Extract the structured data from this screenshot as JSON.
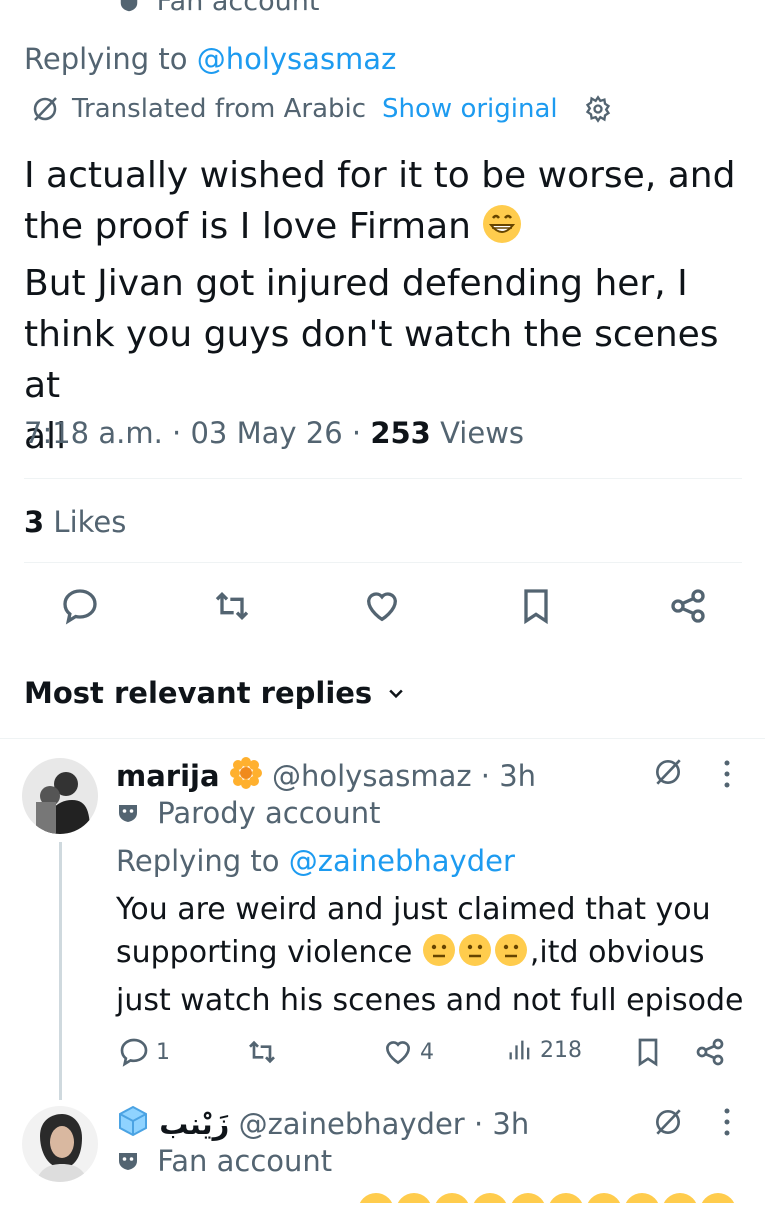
{
  "top_partial": {
    "label": "Fan account"
  },
  "tweet": {
    "replying_prefix": "Replying to",
    "replying_handle": "@holysasmaz",
    "translated_label": "Translated from Arabic",
    "show_original_label": "Show original",
    "text_lines": [
      "I actually wished for it to be worse, and",
      "the proof is I love Firman",
      "But Jivan got injured defending her, I",
      "think you guys don't watch the scenes at",
      "all"
    ],
    "time": "7:18 a.m.",
    "date": "03 May 26",
    "views_count": "253",
    "views_label": "Views",
    "likes_count": "3",
    "likes_label": "Likes"
  },
  "sort": {
    "label": "Most relevant replies"
  },
  "replies": [
    {
      "name": "marija",
      "handle": "@holysasmaz",
      "time": "3h",
      "badge": "Parody account",
      "replying_prefix": "Replying to",
      "replying_handle": "@zainebhayder",
      "text_lines": [
        "You are weird and just claimed that you",
        "supporting violence",
        ",itd  obvious",
        "just watch his scenes and not full episode"
      ],
      "reply_count": "1",
      "like_count": "4",
      "view_count": "218"
    },
    {
      "name": "زَيْنب",
      "handle": "@zainebhayder",
      "time": "3h",
      "badge": "Fan account"
    }
  ],
  "colors": {
    "accent": "#1d9bf0",
    "muted": "#536471",
    "text": "#0f1419",
    "divider": "#eff3f4"
  }
}
